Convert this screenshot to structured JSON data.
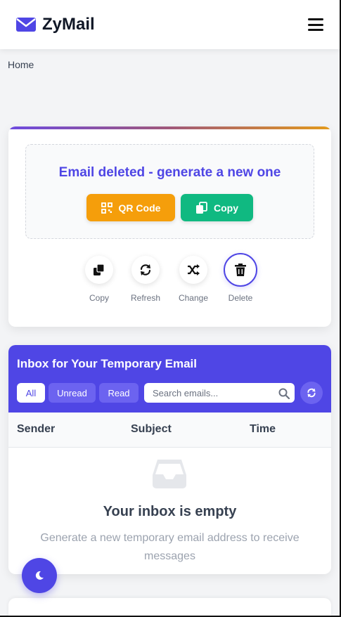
{
  "header": {
    "brand": "ZyMail",
    "logo_icon": "envelope-icon",
    "menu_icon": "hamburger-icon"
  },
  "breadcrumb": {
    "home": "Home"
  },
  "email_card": {
    "message": "Email deleted - generate a new one",
    "qr_button": "QR Code",
    "copy_button": "Copy",
    "actions": [
      {
        "label": "Copy",
        "icon": "copy-icon"
      },
      {
        "label": "Refresh",
        "icon": "refresh-icon"
      },
      {
        "label": "Change",
        "icon": "shuffle-icon"
      },
      {
        "label": "Delete",
        "icon": "trash-icon"
      }
    ]
  },
  "inbox": {
    "title": "Inbox for Your Temporary Email",
    "filters": [
      "All",
      "Unread",
      "Read"
    ],
    "active_filter": "All",
    "search_placeholder": "Search emails...",
    "columns": [
      "Sender",
      "Subject",
      "Time"
    ],
    "empty_title": "Your inbox is empty",
    "empty_desc": "Generate a new temporary email address to receive messages"
  },
  "colors": {
    "primary": "#4f46e5",
    "orange": "#f59e0b",
    "green": "#10b981"
  }
}
